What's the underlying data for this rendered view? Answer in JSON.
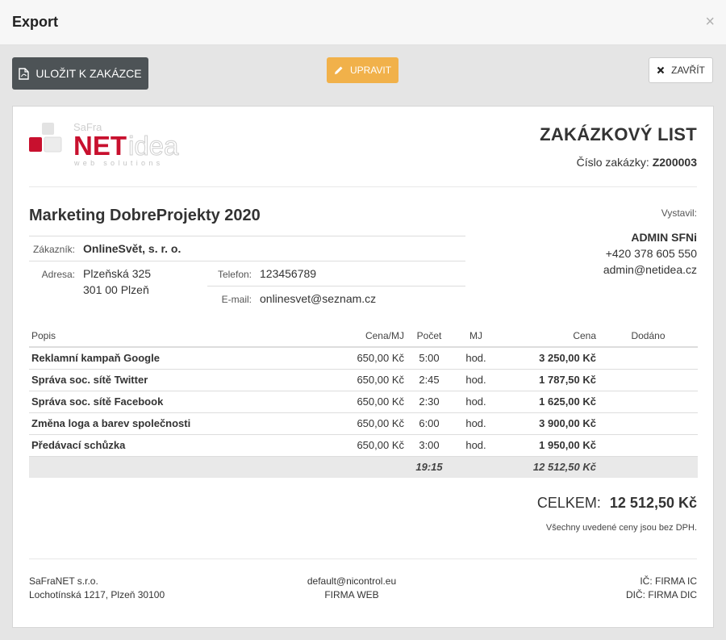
{
  "modal": {
    "title": "Export",
    "close_glyph": "×"
  },
  "toolbar": {
    "save_label": "ULOŽIT K ZAKÁZCE",
    "edit_label": "UPRAVIT",
    "close_label": "ZAVŘÍT",
    "colors": {
      "save_bg": "#4d5356",
      "edit_bg": "#f1b14a",
      "close_bg": "#ffffff"
    }
  },
  "document": {
    "logo": {
      "top": "SaFra",
      "main": "NET",
      "accent": "idea",
      "tagline": "web solutions",
      "brand_color": "#c8102e"
    },
    "title": "ZAKÁZKOVÝ LIST",
    "order_label": "Číslo zakázky:",
    "order_number": "Z200003",
    "project_name": "Marketing DobreProjekty 2020",
    "customer": {
      "label": "Zákazník:",
      "name": "OnlineSvět, s. r. o.",
      "address_label": "Adresa:",
      "address_line1": "Plzeňská 325",
      "address_line2": "301 00 Plzeň",
      "phone_label": "Telefon:",
      "phone": "123456789",
      "email_label": "E-mail:",
      "email": "onlinesvet@seznam.cz"
    },
    "issuer": {
      "label": "Vystavil:",
      "name": "ADMIN SFNi",
      "phone": "+420 378 605 550",
      "email": "admin@netidea.cz"
    },
    "table": {
      "headers": {
        "desc": "Popis",
        "unit_price": "Cena/MJ",
        "qty": "Počet",
        "unit": "MJ",
        "price": "Cena",
        "delivered": "Dodáno"
      },
      "rows": [
        {
          "desc": "Reklamní kampaň Google",
          "unit_price": "650,00 Kč",
          "qty": "5:00",
          "unit": "hod.",
          "price": "3 250,00 Kč",
          "delivered": ""
        },
        {
          "desc": "Správa soc. sítě Twitter",
          "unit_price": "650,00 Kč",
          "qty": "2:45",
          "unit": "hod.",
          "price": "1 787,50 Kč",
          "delivered": ""
        },
        {
          "desc": "Správa soc. sítě Facebook",
          "unit_price": "650,00 Kč",
          "qty": "2:30",
          "unit": "hod.",
          "price": "1 625,00 Kč",
          "delivered": ""
        },
        {
          "desc": "Změna loga a barev společnosti",
          "unit_price": "650,00 Kč",
          "qty": "6:00",
          "unit": "hod.",
          "price": "3 900,00 Kč",
          "delivered": ""
        },
        {
          "desc": "Předávací schůzka",
          "unit_price": "650,00 Kč",
          "qty": "3:00",
          "unit": "hod.",
          "price": "1 950,00 Kč",
          "delivered": ""
        }
      ],
      "total_qty": "19:15",
      "total_price": "12 512,50 Kč"
    },
    "grand_total_label": "CELKEM:",
    "grand_total": "12 512,50 Kč",
    "vat_note": "Všechny uvedené ceny jsou bez DPH.",
    "footer": {
      "company": "SaFraNET s.r.o.",
      "address": "Lochotínská 1217, Plzeň 30100",
      "email": "default@nicontrol.eu",
      "web": "FIRMA WEB",
      "ic": "IČ: FIRMA IC",
      "dic": "DIČ: FIRMA DIC"
    }
  }
}
